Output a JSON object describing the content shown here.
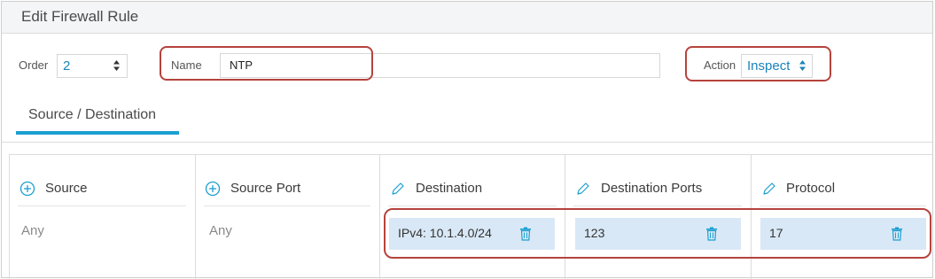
{
  "dialog": {
    "title": "Edit Firewall Rule"
  },
  "form": {
    "order_label": "Order",
    "order_value": "2",
    "name_label": "Name",
    "name_value": "NTP",
    "action_label": "Action",
    "action_value": "Inspect"
  },
  "tabs": [
    {
      "label": "Source / Destination",
      "active": true
    }
  ],
  "columns": {
    "source": {
      "header": "Source",
      "header_icon": "plus-circle-icon",
      "value": "Any"
    },
    "source_port": {
      "header": "Source Port",
      "header_icon": "plus-circle-icon",
      "value": "Any"
    },
    "destination": {
      "header": "Destination",
      "header_icon": "pencil-icon",
      "chip": "IPv4: 10.1.4.0/24"
    },
    "destination_ports": {
      "header": "Destination Ports",
      "header_icon": "pencil-icon",
      "chip": "123"
    },
    "protocol": {
      "header": "Protocol",
      "header_icon": "pencil-icon",
      "chip": "17"
    }
  },
  "colors": {
    "accent": "#1b9fd0",
    "link": "#1b83b8",
    "chip_bg": "#d9e8f6",
    "highlight": "#b5433d"
  }
}
